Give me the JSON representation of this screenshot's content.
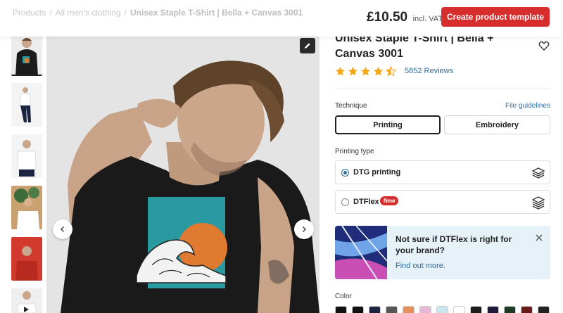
{
  "breadcrumb": {
    "items": [
      "Products",
      "All men's clothing",
      "Unisex Staple T-Shirt | Bella + Canvas 3001"
    ]
  },
  "header": {
    "price": "£10.50",
    "vat": "incl. VAT",
    "create_button": "Create product template"
  },
  "product": {
    "title": "Unisex Staple T-Shirt | Bella + Canvas 3001",
    "rating": 4.5,
    "reviews": "5852 Reviews"
  },
  "technique": {
    "label": "Technique",
    "file_guidelines": "File guidelines",
    "options": [
      "Printing",
      "Embroidery"
    ],
    "selected": "Printing"
  },
  "printing_type": {
    "label": "Printing type",
    "options": [
      {
        "label": "DTG printing",
        "selected": true
      },
      {
        "label": "DTFlex",
        "badge": "New",
        "selected": false
      }
    ]
  },
  "promo": {
    "text": "Not sure if DTFlex is right for your brand?",
    "link": "Find out more."
  },
  "color": {
    "label": "Color",
    "swatches": [
      "#111111",
      "#111111",
      "#1b2540",
      "#555555",
      "#e8905a",
      "#e6b8d6",
      "#c9e6ee",
      "#ffffff",
      "#1c1c1c",
      "#1e1b3b",
      "#1e3b26",
      "#6b1a1a",
      "#222222"
    ]
  },
  "colors": {
    "accent": "#d72d2d",
    "link": "#2d6ca2",
    "star": "#f3a81c"
  }
}
